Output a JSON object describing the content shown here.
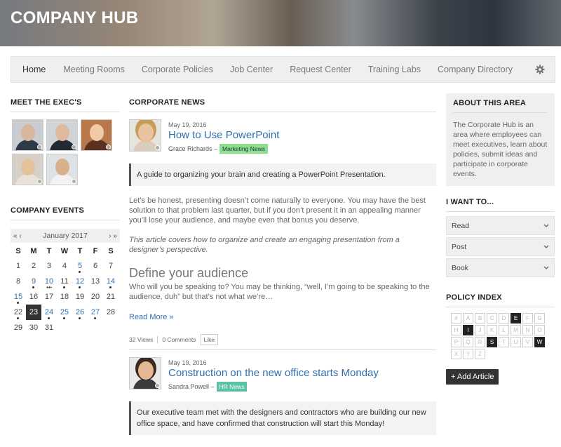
{
  "header": {
    "title": "COMPANY HUB"
  },
  "nav": {
    "items": [
      "Home",
      "Meeting Rooms",
      "Corporate Policies",
      "Job Center",
      "Request Center",
      "Training Labs",
      "Company Directory"
    ]
  },
  "left": {
    "execs_title": "MEET THE EXEC'S",
    "events_title": "COMPANY EVENTS",
    "calendar": {
      "prev_year": "«",
      "prev_month": "‹",
      "month": "January 2017",
      "next_month": "›",
      "next_year": "»",
      "dow": [
        "S",
        "M",
        "T",
        "W",
        "T",
        "F",
        "S"
      ],
      "days": [
        "1",
        "2",
        "3",
        "4",
        "5",
        "6",
        "7",
        "8",
        "9",
        "10",
        "11",
        "12",
        "13",
        "14",
        "15",
        "16",
        "17",
        "18",
        "19",
        "20",
        "21",
        "22",
        "23",
        "24",
        "25",
        "26",
        "27",
        "28",
        "29",
        "30",
        "31"
      ]
    }
  },
  "center": {
    "title": "CORPORATE NEWS",
    "post1": {
      "date": "May 19, 2016",
      "title": "How to Use PowerPoint",
      "author": "Grace Richards –",
      "tag": "Marketing News",
      "lead": "A guide to organizing your brain and creating a PowerPoint Presentation.",
      "p1": "Let’s be honest, presenting doesn’t come naturally to everyone. You may have the best solution to that problem last quarter, but if you don’t present it in an appealing manner you’ll lose your audience, and maybe even that bonus you deserve.",
      "p2": "This article covers how to organize and create an engaging presentation from a designer’s perspective.",
      "h2": "Define your audience",
      "p3": "Who will you be speaking to? You may be thinking, “well, I’m going to be speaking to the audience, duh” but that’s not what we’re…",
      "read_more": "Read More »",
      "views": "32 Views",
      "comments": "0 Comments",
      "like": "Like"
    },
    "post2": {
      "date": "May 19, 2016",
      "title": "Construction on the new office starts Monday",
      "author": "Sandra Powell –",
      "tag": "HR News",
      "lead": "Our executive team met with the designers and contractors who are building our new office space, and have confirmed that construction will start this Monday!"
    }
  },
  "right": {
    "about_title": "ABOUT THIS AREA",
    "about_text": "The Corporate Hub is an area where employees can meet executives, learn about policies, submit ideas and participate in corporate events.",
    "iwant_title": "I WANT TO...",
    "options": [
      "Read",
      "Post",
      "Book"
    ],
    "policy_title": "POLICY INDEX",
    "letters": [
      "#",
      "A",
      "B",
      "C",
      "D",
      "E",
      "F",
      "G",
      "H",
      "I",
      "J",
      "K",
      "L",
      "M",
      "N",
      "O",
      "P",
      "Q",
      "R",
      "S",
      "T",
      "U",
      "V",
      "W",
      "X",
      "Y",
      "Z"
    ],
    "active_letters": [
      "E",
      "I",
      "S",
      "W"
    ],
    "add_button": "+ Add Article"
  },
  "colors": {
    "accent_link": "#2e6fb0",
    "tag_marketing": "#8ee08e",
    "tag_hr": "#5cc2a6",
    "dark": "#333333"
  }
}
